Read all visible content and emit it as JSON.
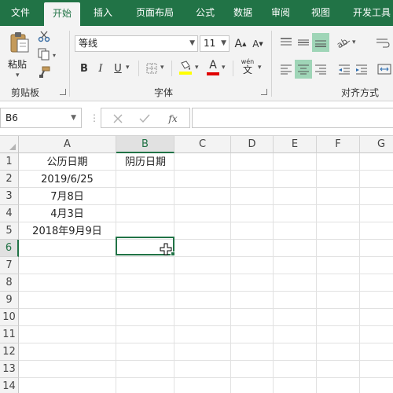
{
  "tabs": [
    {
      "label": "文件",
      "active": false
    },
    {
      "label": "开始",
      "active": true
    },
    {
      "label": "插入",
      "active": false
    },
    {
      "label": "页面布局",
      "active": false
    },
    {
      "label": "公式",
      "active": false
    },
    {
      "label": "数据",
      "active": false
    },
    {
      "label": "审阅",
      "active": false
    },
    {
      "label": "视图",
      "active": false
    },
    {
      "label": "开发工具",
      "active": false
    }
  ],
  "ribbon": {
    "clipboard": {
      "paste_label": "粘贴",
      "group_label": "剪贴板"
    },
    "font": {
      "font_name": "等线",
      "font_size": "11",
      "group_label": "字体",
      "grow": "A",
      "shrink": "A",
      "bold": "B",
      "italic": "I",
      "underline": "U",
      "font_color": "A",
      "phonetic": "wén"
    },
    "alignment": {
      "group_label": "对齐方式"
    }
  },
  "formula_bar": {
    "name_box": "B6",
    "fx": "fx",
    "formula": ""
  },
  "sheet": {
    "columns": [
      "A",
      "B",
      "C",
      "D",
      "E",
      "F",
      "G"
    ],
    "rows": [
      "1",
      "2",
      "3",
      "4",
      "5",
      "6",
      "7",
      "8",
      "9",
      "10",
      "11",
      "12",
      "13",
      "14"
    ],
    "active_cell": "B6",
    "cells": {
      "A1": "公历日期",
      "B1": "阴历日期",
      "A2": "2019/6/25",
      "A3": "7月8日",
      "A4": "4月3日",
      "A5": "2018年9月9日"
    }
  },
  "colors": {
    "accent": "#217346",
    "ribbon_bg": "#f3f3f3",
    "gridline": "#e1e1e1"
  }
}
